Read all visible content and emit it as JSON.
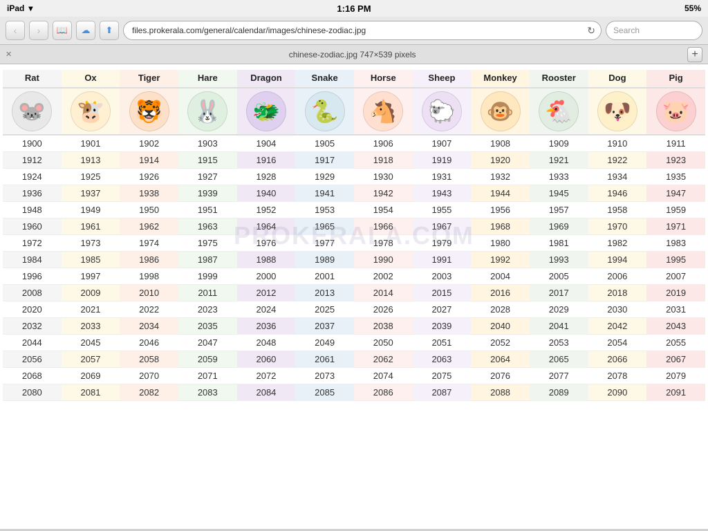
{
  "statusBar": {
    "device": "iPad",
    "wifi": "wifi",
    "time": "1:16 PM",
    "battery": "55%"
  },
  "browser": {
    "url": "files.prokerala.com/general/calendar/images/chinese-zodiac.jpg",
    "searchPlaceholder": "Search",
    "tabTitle": "chinese-zodiac.jpg 747×539 pixels"
  },
  "zodiac": {
    "animals": [
      {
        "name": "Rat",
        "emoji": "🐭",
        "color": "#f5f5f5",
        "iconBg": "#e8e8e8"
      },
      {
        "name": "Ox",
        "emoji": "🐮",
        "color": "#fef9e7",
        "iconBg": "#fef0d0"
      },
      {
        "name": "Tiger",
        "emoji": "🐯",
        "color": "#fef0e7",
        "iconBg": "#fde0c8"
      },
      {
        "name": "Hare",
        "emoji": "🐰",
        "color": "#f0f8f0",
        "iconBg": "#e0f0e0"
      },
      {
        "name": "Dragon",
        "emoji": "🐲",
        "color": "#f0e8f5",
        "iconBg": "#e0d0f0"
      },
      {
        "name": "Snake",
        "emoji": "🐍",
        "color": "#e8f0f8",
        "iconBg": "#d8e8f0"
      },
      {
        "name": "Horse",
        "emoji": "🐴",
        "color": "#fff0f0",
        "iconBg": "#ffe0d0"
      },
      {
        "name": "Sheep",
        "emoji": "🐑",
        "color": "#f5f0fa",
        "iconBg": "#ede0f5"
      },
      {
        "name": "Monkey",
        "emoji": "🐵",
        "color": "#fff5e0",
        "iconBg": "#ffe8c0"
      },
      {
        "name": "Rooster",
        "emoji": "🐔",
        "color": "#f0f5f0",
        "iconBg": "#e0ede0"
      },
      {
        "name": "Dog",
        "emoji": "🐶",
        "color": "#fef9e7",
        "iconBg": "#fef0c8"
      },
      {
        "name": "Pig",
        "emoji": "🐷",
        "color": "#fde8e8",
        "iconBg": "#fcd0d0"
      }
    ],
    "years": [
      [
        1900,
        1901,
        1902,
        1903,
        1904,
        1905,
        1906,
        1907,
        1908,
        1909,
        1910,
        1911
      ],
      [
        1912,
        1913,
        1914,
        1915,
        1916,
        1917,
        1918,
        1919,
        1920,
        1921,
        1922,
        1923
      ],
      [
        1924,
        1925,
        1926,
        1927,
        1928,
        1929,
        1930,
        1931,
        1932,
        1933,
        1934,
        1935
      ],
      [
        1936,
        1937,
        1938,
        1939,
        1940,
        1941,
        1942,
        1943,
        1944,
        1945,
        1946,
        1947
      ],
      [
        1948,
        1949,
        1950,
        1951,
        1952,
        1953,
        1954,
        1955,
        1956,
        1957,
        1958,
        1959
      ],
      [
        1960,
        1961,
        1962,
        1963,
        1964,
        1965,
        1966,
        1967,
        1968,
        1969,
        1970,
        1971
      ],
      [
        1972,
        1973,
        1974,
        1975,
        1976,
        1977,
        1978,
        1979,
        1980,
        1981,
        1982,
        1983
      ],
      [
        1984,
        1985,
        1986,
        1987,
        1988,
        1989,
        1990,
        1991,
        1992,
        1993,
        1994,
        1995
      ],
      [
        1996,
        1997,
        1998,
        1999,
        2000,
        2001,
        2002,
        2003,
        2004,
        2005,
        2006,
        2007
      ],
      [
        2008,
        2009,
        2010,
        2011,
        2012,
        2013,
        2014,
        2015,
        2016,
        2017,
        2018,
        2019
      ],
      [
        2020,
        2021,
        2022,
        2023,
        2024,
        2025,
        2026,
        2027,
        2028,
        2029,
        2030,
        2031
      ],
      [
        2032,
        2033,
        2034,
        2035,
        2036,
        2037,
        2038,
        2039,
        2040,
        2041,
        2042,
        2043
      ],
      [
        2044,
        2045,
        2046,
        2047,
        2048,
        2049,
        2050,
        2051,
        2052,
        2053,
        2054,
        2055
      ],
      [
        2056,
        2057,
        2058,
        2059,
        2060,
        2061,
        2062,
        2063,
        2064,
        2065,
        2066,
        2067
      ],
      [
        2068,
        2069,
        2070,
        2071,
        2072,
        2073,
        2074,
        2075,
        2076,
        2077,
        2078,
        2079
      ],
      [
        2080,
        2081,
        2082,
        2083,
        2084,
        2085,
        2086,
        2087,
        2088,
        2089,
        2090,
        2091
      ]
    ],
    "watermark": "PROKERALA.COM"
  }
}
